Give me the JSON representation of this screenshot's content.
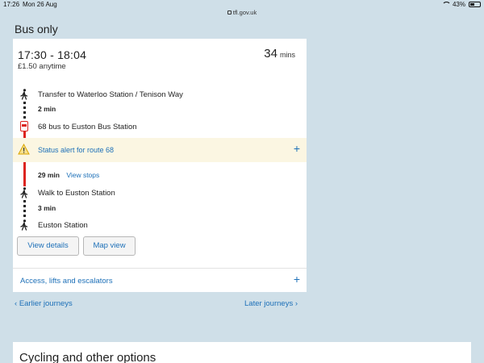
{
  "status_bar": {
    "time": "17:26",
    "date": "Mon 26 Aug",
    "url": "tfl.gov.uk",
    "battery": "43%",
    "battery_level": 0.43
  },
  "section_title": "Bus only",
  "journey": {
    "times": "17:30 - 18:04",
    "fare": "£1.50 anytime",
    "duration_value": "34",
    "duration_unit": "mins",
    "steps": {
      "transfer": "Transfer to Waterloo Station / Tenison Way",
      "transfer_duration": "2 min",
      "bus": "68 bus to Euston Bus Station",
      "bus_duration": "29 min",
      "view_stops": "View stops",
      "walk": "Walk to Euston Station",
      "walk_duration": "3 min",
      "destination": "Euston Station"
    },
    "alert": "Status alert for route 68",
    "buttons": {
      "view_details": "View details",
      "map_view": "Map view"
    },
    "access": "Access, lifts and escalators"
  },
  "nav": {
    "earlier": "Earlier journeys",
    "later": "Later journeys"
  },
  "other_options_title": "Cycling and other options",
  "colors": {
    "accent": "#1d70b8",
    "bus_red": "#dc241f",
    "background": "#cfdfe8",
    "alert_bg": "#fbf6e2"
  },
  "icons": [
    "wifi-icon",
    "battery-icon",
    "lock-icon",
    "walk-icon",
    "bus-icon",
    "warning-icon",
    "plus-icon",
    "chevron-left-icon",
    "chevron-right-icon"
  ]
}
